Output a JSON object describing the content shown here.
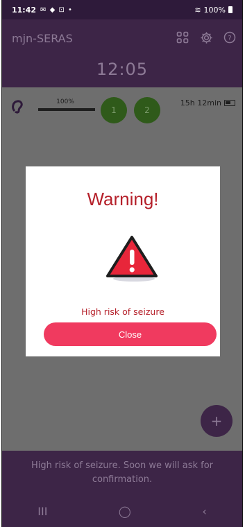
{
  "status_bar": {
    "time": "11:42",
    "left_icons": "✉ ◆ ⊡ •",
    "battery": "100%"
  },
  "app": {
    "title": "mjn-SERAS",
    "clock": "12:05"
  },
  "header_icons": {
    "grid": "grid-icon",
    "settings": "gear-icon",
    "help": "help-icon"
  },
  "device": {
    "level_label": "100%",
    "level_fraction": 1.0,
    "channel_1": "1",
    "channel_2": "2",
    "battery_time": "15h 12min"
  },
  "fab": {
    "label": "+"
  },
  "bottom": {
    "message": "High risk of seizure. Soon we will ask for confirmation."
  },
  "nav": {
    "recents": "III",
    "home": "◯",
    "back": "‹"
  },
  "modal": {
    "title": "Warning!",
    "message": "High risk of seizure",
    "close_label": "Close"
  },
  "colors": {
    "accent": "#f03a5f",
    "warning_text": "#b5202a",
    "brand_purple": "#5b2d6e",
    "channel_green": "#5ea62f"
  }
}
